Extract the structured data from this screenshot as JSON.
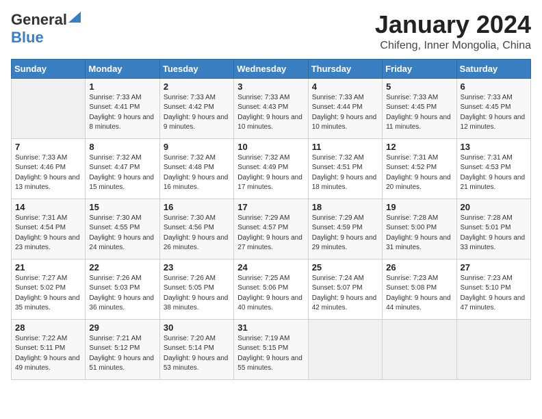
{
  "logo": {
    "general": "General",
    "blue": "Blue"
  },
  "header": {
    "month": "January 2024",
    "location": "Chifeng, Inner Mongolia, China"
  },
  "days_of_week": [
    "Sunday",
    "Monday",
    "Tuesday",
    "Wednesday",
    "Thursday",
    "Friday",
    "Saturday"
  ],
  "weeks": [
    [
      {
        "day": "",
        "sunrise": "",
        "sunset": "",
        "daylight": "",
        "empty": true
      },
      {
        "day": "1",
        "sunrise": "Sunrise: 7:33 AM",
        "sunset": "Sunset: 4:41 PM",
        "daylight": "Daylight: 9 hours and 8 minutes."
      },
      {
        "day": "2",
        "sunrise": "Sunrise: 7:33 AM",
        "sunset": "Sunset: 4:42 PM",
        "daylight": "Daylight: 9 hours and 9 minutes."
      },
      {
        "day": "3",
        "sunrise": "Sunrise: 7:33 AM",
        "sunset": "Sunset: 4:43 PM",
        "daylight": "Daylight: 9 hours and 10 minutes."
      },
      {
        "day": "4",
        "sunrise": "Sunrise: 7:33 AM",
        "sunset": "Sunset: 4:44 PM",
        "daylight": "Daylight: 9 hours and 10 minutes."
      },
      {
        "day": "5",
        "sunrise": "Sunrise: 7:33 AM",
        "sunset": "Sunset: 4:45 PM",
        "daylight": "Daylight: 9 hours and 11 minutes."
      },
      {
        "day": "6",
        "sunrise": "Sunrise: 7:33 AM",
        "sunset": "Sunset: 4:45 PM",
        "daylight": "Daylight: 9 hours and 12 minutes."
      }
    ],
    [
      {
        "day": "7",
        "sunrise": "Sunrise: 7:33 AM",
        "sunset": "Sunset: 4:46 PM",
        "daylight": "Daylight: 9 hours and 13 minutes."
      },
      {
        "day": "8",
        "sunrise": "Sunrise: 7:32 AM",
        "sunset": "Sunset: 4:47 PM",
        "daylight": "Daylight: 9 hours and 15 minutes."
      },
      {
        "day": "9",
        "sunrise": "Sunrise: 7:32 AM",
        "sunset": "Sunset: 4:48 PM",
        "daylight": "Daylight: 9 hours and 16 minutes."
      },
      {
        "day": "10",
        "sunrise": "Sunrise: 7:32 AM",
        "sunset": "Sunset: 4:49 PM",
        "daylight": "Daylight: 9 hours and 17 minutes."
      },
      {
        "day": "11",
        "sunrise": "Sunrise: 7:32 AM",
        "sunset": "Sunset: 4:51 PM",
        "daylight": "Daylight: 9 hours and 18 minutes."
      },
      {
        "day": "12",
        "sunrise": "Sunrise: 7:31 AM",
        "sunset": "Sunset: 4:52 PM",
        "daylight": "Daylight: 9 hours and 20 minutes."
      },
      {
        "day": "13",
        "sunrise": "Sunrise: 7:31 AM",
        "sunset": "Sunset: 4:53 PM",
        "daylight": "Daylight: 9 hours and 21 minutes."
      }
    ],
    [
      {
        "day": "14",
        "sunrise": "Sunrise: 7:31 AM",
        "sunset": "Sunset: 4:54 PM",
        "daylight": "Daylight: 9 hours and 23 minutes."
      },
      {
        "day": "15",
        "sunrise": "Sunrise: 7:30 AM",
        "sunset": "Sunset: 4:55 PM",
        "daylight": "Daylight: 9 hours and 24 minutes."
      },
      {
        "day": "16",
        "sunrise": "Sunrise: 7:30 AM",
        "sunset": "Sunset: 4:56 PM",
        "daylight": "Daylight: 9 hours and 26 minutes."
      },
      {
        "day": "17",
        "sunrise": "Sunrise: 7:29 AM",
        "sunset": "Sunset: 4:57 PM",
        "daylight": "Daylight: 9 hours and 27 minutes."
      },
      {
        "day": "18",
        "sunrise": "Sunrise: 7:29 AM",
        "sunset": "Sunset: 4:59 PM",
        "daylight": "Daylight: 9 hours and 29 minutes."
      },
      {
        "day": "19",
        "sunrise": "Sunrise: 7:28 AM",
        "sunset": "Sunset: 5:00 PM",
        "daylight": "Daylight: 9 hours and 31 minutes."
      },
      {
        "day": "20",
        "sunrise": "Sunrise: 7:28 AM",
        "sunset": "Sunset: 5:01 PM",
        "daylight": "Daylight: 9 hours and 33 minutes."
      }
    ],
    [
      {
        "day": "21",
        "sunrise": "Sunrise: 7:27 AM",
        "sunset": "Sunset: 5:02 PM",
        "daylight": "Daylight: 9 hours and 35 minutes."
      },
      {
        "day": "22",
        "sunrise": "Sunrise: 7:26 AM",
        "sunset": "Sunset: 5:03 PM",
        "daylight": "Daylight: 9 hours and 36 minutes."
      },
      {
        "day": "23",
        "sunrise": "Sunrise: 7:26 AM",
        "sunset": "Sunset: 5:05 PM",
        "daylight": "Daylight: 9 hours and 38 minutes."
      },
      {
        "day": "24",
        "sunrise": "Sunrise: 7:25 AM",
        "sunset": "Sunset: 5:06 PM",
        "daylight": "Daylight: 9 hours and 40 minutes."
      },
      {
        "day": "25",
        "sunrise": "Sunrise: 7:24 AM",
        "sunset": "Sunset: 5:07 PM",
        "daylight": "Daylight: 9 hours and 42 minutes."
      },
      {
        "day": "26",
        "sunrise": "Sunrise: 7:23 AM",
        "sunset": "Sunset: 5:08 PM",
        "daylight": "Daylight: 9 hours and 44 minutes."
      },
      {
        "day": "27",
        "sunrise": "Sunrise: 7:23 AM",
        "sunset": "Sunset: 5:10 PM",
        "daylight": "Daylight: 9 hours and 47 minutes."
      }
    ],
    [
      {
        "day": "28",
        "sunrise": "Sunrise: 7:22 AM",
        "sunset": "Sunset: 5:11 PM",
        "daylight": "Daylight: 9 hours and 49 minutes."
      },
      {
        "day": "29",
        "sunrise": "Sunrise: 7:21 AM",
        "sunset": "Sunset: 5:12 PM",
        "daylight": "Daylight: 9 hours and 51 minutes."
      },
      {
        "day": "30",
        "sunrise": "Sunrise: 7:20 AM",
        "sunset": "Sunset: 5:14 PM",
        "daylight": "Daylight: 9 hours and 53 minutes."
      },
      {
        "day": "31",
        "sunrise": "Sunrise: 7:19 AM",
        "sunset": "Sunset: 5:15 PM",
        "daylight": "Daylight: 9 hours and 55 minutes."
      },
      {
        "day": "",
        "sunrise": "",
        "sunset": "",
        "daylight": "",
        "empty": true
      },
      {
        "day": "",
        "sunrise": "",
        "sunset": "",
        "daylight": "",
        "empty": true
      },
      {
        "day": "",
        "sunrise": "",
        "sunset": "",
        "daylight": "",
        "empty": true
      }
    ]
  ]
}
